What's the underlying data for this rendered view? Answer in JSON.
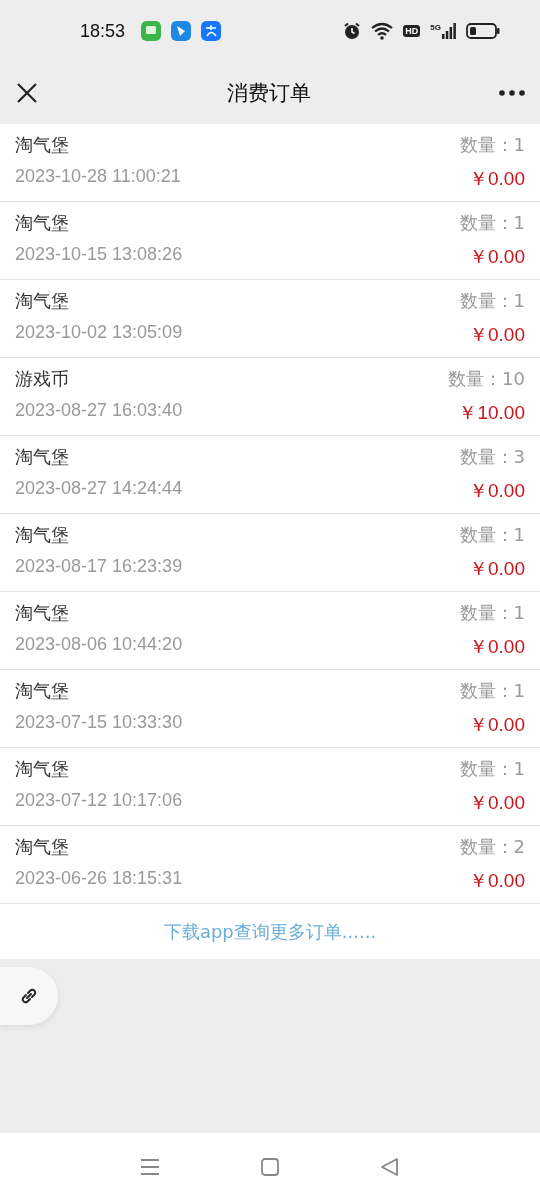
{
  "status_bar": {
    "time": "18:53",
    "hd": "HD",
    "network": "5G"
  },
  "header": {
    "title": "消费订单"
  },
  "orders": [
    {
      "name": "淘气堡",
      "quantity_label": "数量：",
      "quantity": "1",
      "time": "2023-10-28 11:00:21",
      "price": "￥0.00"
    },
    {
      "name": "淘气堡",
      "quantity_label": "数量：",
      "quantity": "1",
      "time": "2023-10-15 13:08:26",
      "price": "￥0.00"
    },
    {
      "name": "淘气堡",
      "quantity_label": "数量：",
      "quantity": "1",
      "time": "2023-10-02 13:05:09",
      "price": "￥0.00"
    },
    {
      "name": "游戏币",
      "quantity_label": "数量：",
      "quantity": "10",
      "time": "2023-08-27 16:03:40",
      "price": "￥10.00"
    },
    {
      "name": "淘气堡",
      "quantity_label": "数量：",
      "quantity": "3",
      "time": "2023-08-27 14:24:44",
      "price": "￥0.00"
    },
    {
      "name": "淘气堡",
      "quantity_label": "数量：",
      "quantity": "1",
      "time": "2023-08-17 16:23:39",
      "price": "￥0.00"
    },
    {
      "name": "淘气堡",
      "quantity_label": "数量：",
      "quantity": "1",
      "time": "2023-08-06 10:44:20",
      "price": "￥0.00"
    },
    {
      "name": "淘气堡",
      "quantity_label": "数量：",
      "quantity": "1",
      "time": "2023-07-15 10:33:30",
      "price": "￥0.00"
    },
    {
      "name": "淘气堡",
      "quantity_label": "数量：",
      "quantity": "1",
      "time": "2023-07-12 10:17:06",
      "price": "￥0.00"
    },
    {
      "name": "淘气堡",
      "quantity_label": "数量：",
      "quantity": "2",
      "time": "2023-06-26 18:15:31",
      "price": "￥0.00"
    }
  ],
  "footer_link": "下载app查询更多订单......"
}
